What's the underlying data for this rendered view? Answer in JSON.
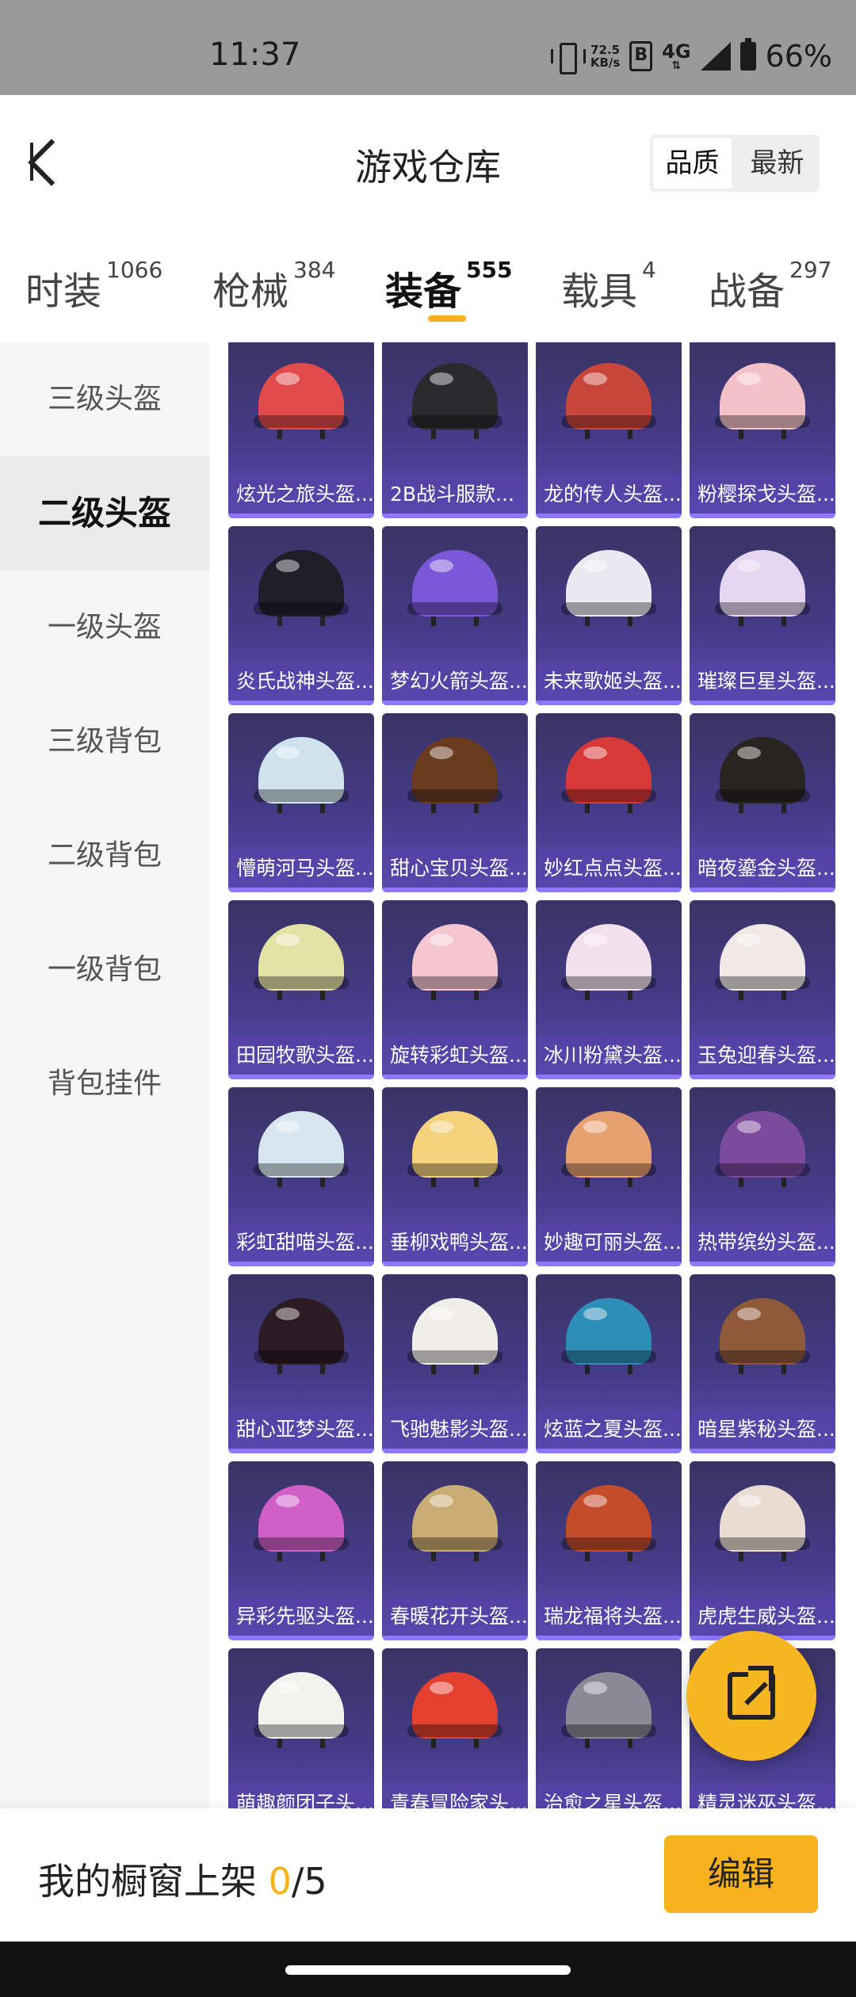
{
  "status_bar": {
    "time": "11:37",
    "net_speed_value": "72.5",
    "net_speed_unit": "KB/s",
    "hd_badge": "B",
    "network": "4G",
    "battery": "66%"
  },
  "header": {
    "title": "游戏仓库",
    "sort_quality": "品质",
    "sort_latest": "最新"
  },
  "tabs": [
    {
      "label": "时装",
      "count": "1066"
    },
    {
      "label": "枪械",
      "count": "384"
    },
    {
      "label": "装备",
      "count": "555"
    },
    {
      "label": "载具",
      "count": "4"
    },
    {
      "label": "战备",
      "count": "297"
    }
  ],
  "active_tab": "装备",
  "sidebar": [
    {
      "label": "三级头盔"
    },
    {
      "label": "二级头盔"
    },
    {
      "label": "一级头盔"
    },
    {
      "label": "三级背包"
    },
    {
      "label": "二级背包"
    },
    {
      "label": "一级背包"
    },
    {
      "label": "背包挂件"
    }
  ],
  "active_sidebar": "二级头盔",
  "items": [
    {
      "name": "炫光之旅头盔...",
      "color": "#e24b4b"
    },
    {
      "name": "2B战斗服款...",
      "color": "#2a2a2e"
    },
    {
      "name": "龙的传人头盔...",
      "color": "#c8463a"
    },
    {
      "name": "粉樱探戈头盔...",
      "color": "#f3c2c8"
    },
    {
      "name": "炎氏战神头盔...",
      "color": "#1f1d28"
    },
    {
      "name": "梦幻火箭头盔...",
      "color": "#7b58d8"
    },
    {
      "name": "未来歌姬头盔...",
      "color": "#e9e9f2"
    },
    {
      "name": "璀璨巨星头盔...",
      "color": "#e6d6f0"
    },
    {
      "name": "懵萌河马头盔...",
      "color": "#cfe3ef"
    },
    {
      "name": "甜心宝贝头盔...",
      "color": "#6b3b1f"
    },
    {
      "name": "妙红点点头盔...",
      "color": "#d93838"
    },
    {
      "name": "暗夜鎏金头盔...",
      "color": "#2a2420"
    },
    {
      "name": "田园牧歌头盔...",
      "color": "#e5e2a6"
    },
    {
      "name": "旋转彩虹头盔...",
      "color": "#f4c6cf"
    },
    {
      "name": "冰川粉黛头盔...",
      "color": "#f2e1ec"
    },
    {
      "name": "玉兔迎春头盔...",
      "color": "#f0e9e6"
    },
    {
      "name": "彩虹甜喵头盔...",
      "color": "#d7e6f1"
    },
    {
      "name": "垂柳戏鸭头盔...",
      "color": "#f3d27a"
    },
    {
      "name": "妙趣可丽头盔...",
      "color": "#e7a070"
    },
    {
      "name": "热带缤纷头盔...",
      "color": "#7d4b9e"
    },
    {
      "name": "甜心亚梦头盔...",
      "color": "#2b1b22"
    },
    {
      "name": "飞驰魅影头盔...",
      "color": "#f0eee9"
    },
    {
      "name": "炫蓝之夏头盔...",
      "color": "#2c8fb8"
    },
    {
      "name": "暗星紫秘头盔...",
      "color": "#8e5a3a"
    },
    {
      "name": "异彩先驱头盔...",
      "color": "#d060c8"
    },
    {
      "name": "春暖花开头盔...",
      "color": "#c9ad74"
    },
    {
      "name": "瑞龙福将头盔...",
      "color": "#c44c2a"
    },
    {
      "name": "虎虎生威头盔...",
      "color": "#e9dcd2"
    },
    {
      "name": "萌趣颜团子头...",
      "color": "#f3f3ee"
    },
    {
      "name": "青春冒险家头...",
      "color": "#e3402f"
    },
    {
      "name": "治愈之星头盔...",
      "color": "#8a8a96"
    },
    {
      "name": "精灵迷巫头盔...",
      "color": "#6b5aa8"
    }
  ],
  "showcase": {
    "prefix": "我的橱窗上架 ",
    "count": "0",
    "total": "/5"
  },
  "edit_label": "编辑",
  "colors": {
    "accent": "#f5b21b",
    "card_bg": "#453a86"
  },
  "icons": {
    "back": "chevron-left-icon",
    "share": "share-external-icon"
  }
}
